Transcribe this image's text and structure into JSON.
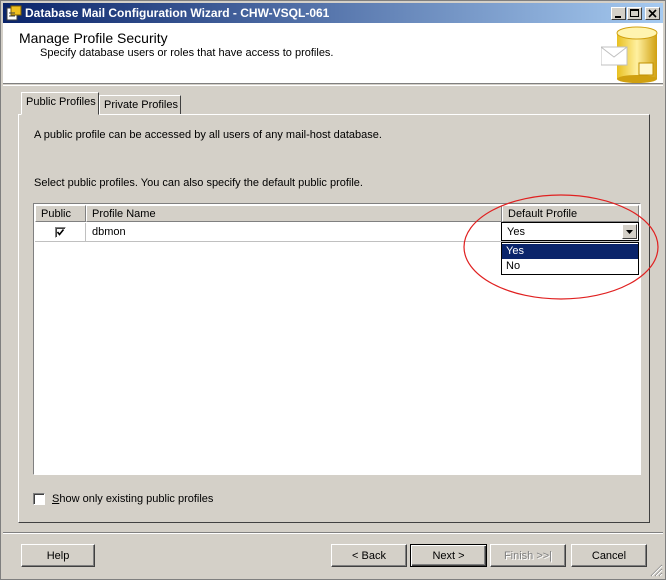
{
  "window": {
    "title": "Database Mail Configuration Wizard - CHW-VSQL-061"
  },
  "header": {
    "title": "Manage Profile Security",
    "subtitle": "Specify database users or roles that have access to profiles."
  },
  "tabs": [
    {
      "label": "Public Profiles",
      "active": true
    },
    {
      "label": "Private Profiles",
      "active": false
    }
  ],
  "panel": {
    "description": "A public profile can be accessed by all users of any mail-host database.",
    "instruction": "Select public profiles. You can also specify the default public profile."
  },
  "grid": {
    "columns": [
      "Public",
      "Profile Name",
      "Default Profile"
    ],
    "rows": [
      {
        "public": true,
        "profile_name": "dbmon",
        "default_profile": "Yes"
      }
    ]
  },
  "dropdown": {
    "options": [
      "Yes",
      "No"
    ],
    "selected": "Yes"
  },
  "show_existing": {
    "label": "Show only existing public profiles",
    "checked": false
  },
  "buttons": {
    "help": "Help",
    "back": "< Back",
    "next": "Next >",
    "finish": "Finish >>|",
    "cancel": "Cancel"
  },
  "colors": {
    "title_bar_start": "#0a246a",
    "title_bar_end": "#a6caf0",
    "highlight": "#0a246a",
    "annotation_circle": "#e02020",
    "face": "#d4d0c8"
  }
}
